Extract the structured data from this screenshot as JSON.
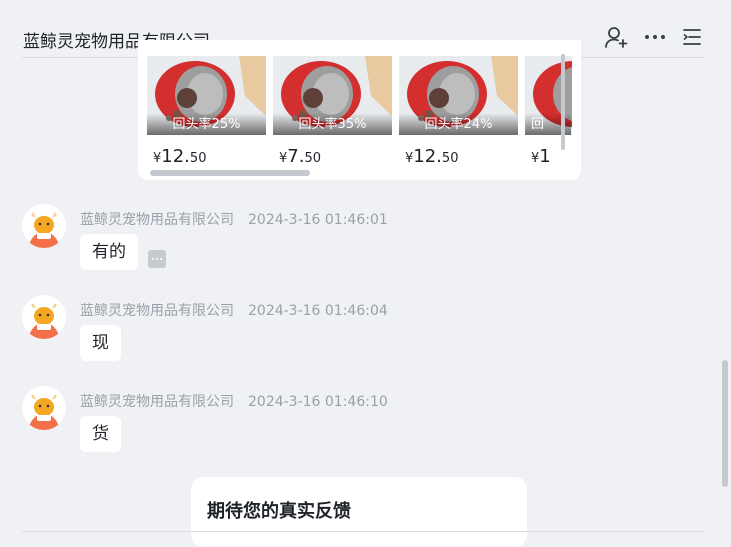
{
  "header": {
    "title": "蓝鲸灵宠物用品有限公司",
    "icons": [
      "add-contact-icon",
      "more-icon",
      "menu-list-icon"
    ]
  },
  "products": [
    {
      "rate": "回头率25%",
      "currency": "¥",
      "price_int": "12.",
      "price_dec": "50"
    },
    {
      "rate": "回头率35%",
      "currency": "¥",
      "price_int": "7.",
      "price_dec": "50"
    },
    {
      "rate": "回头率24%",
      "currency": "¥",
      "price_int": "12.",
      "price_dec": "50"
    },
    {
      "rate": "回",
      "currency": "¥",
      "price_int": "1",
      "price_dec": ""
    }
  ],
  "messages": [
    {
      "sender": "蓝鲸灵宠物用品有限公司",
      "time": "2024-3-16 01:46:01",
      "text": "有的"
    },
    {
      "sender": "蓝鲸灵宠物用品有限公司",
      "time": "2024-3-16 01:46:04",
      "text": "现"
    },
    {
      "sender": "蓝鲸灵宠物用品有限公司",
      "time": "2024-3-16 01:46:10",
      "text": "货"
    }
  ],
  "feedback": {
    "title": "期待您的真实反馈"
  },
  "colors": {
    "background": "#f0f1f5",
    "card": "#ffffff",
    "meta_text": "#9aa0a8",
    "scrollbar": "#c4c8cf"
  }
}
